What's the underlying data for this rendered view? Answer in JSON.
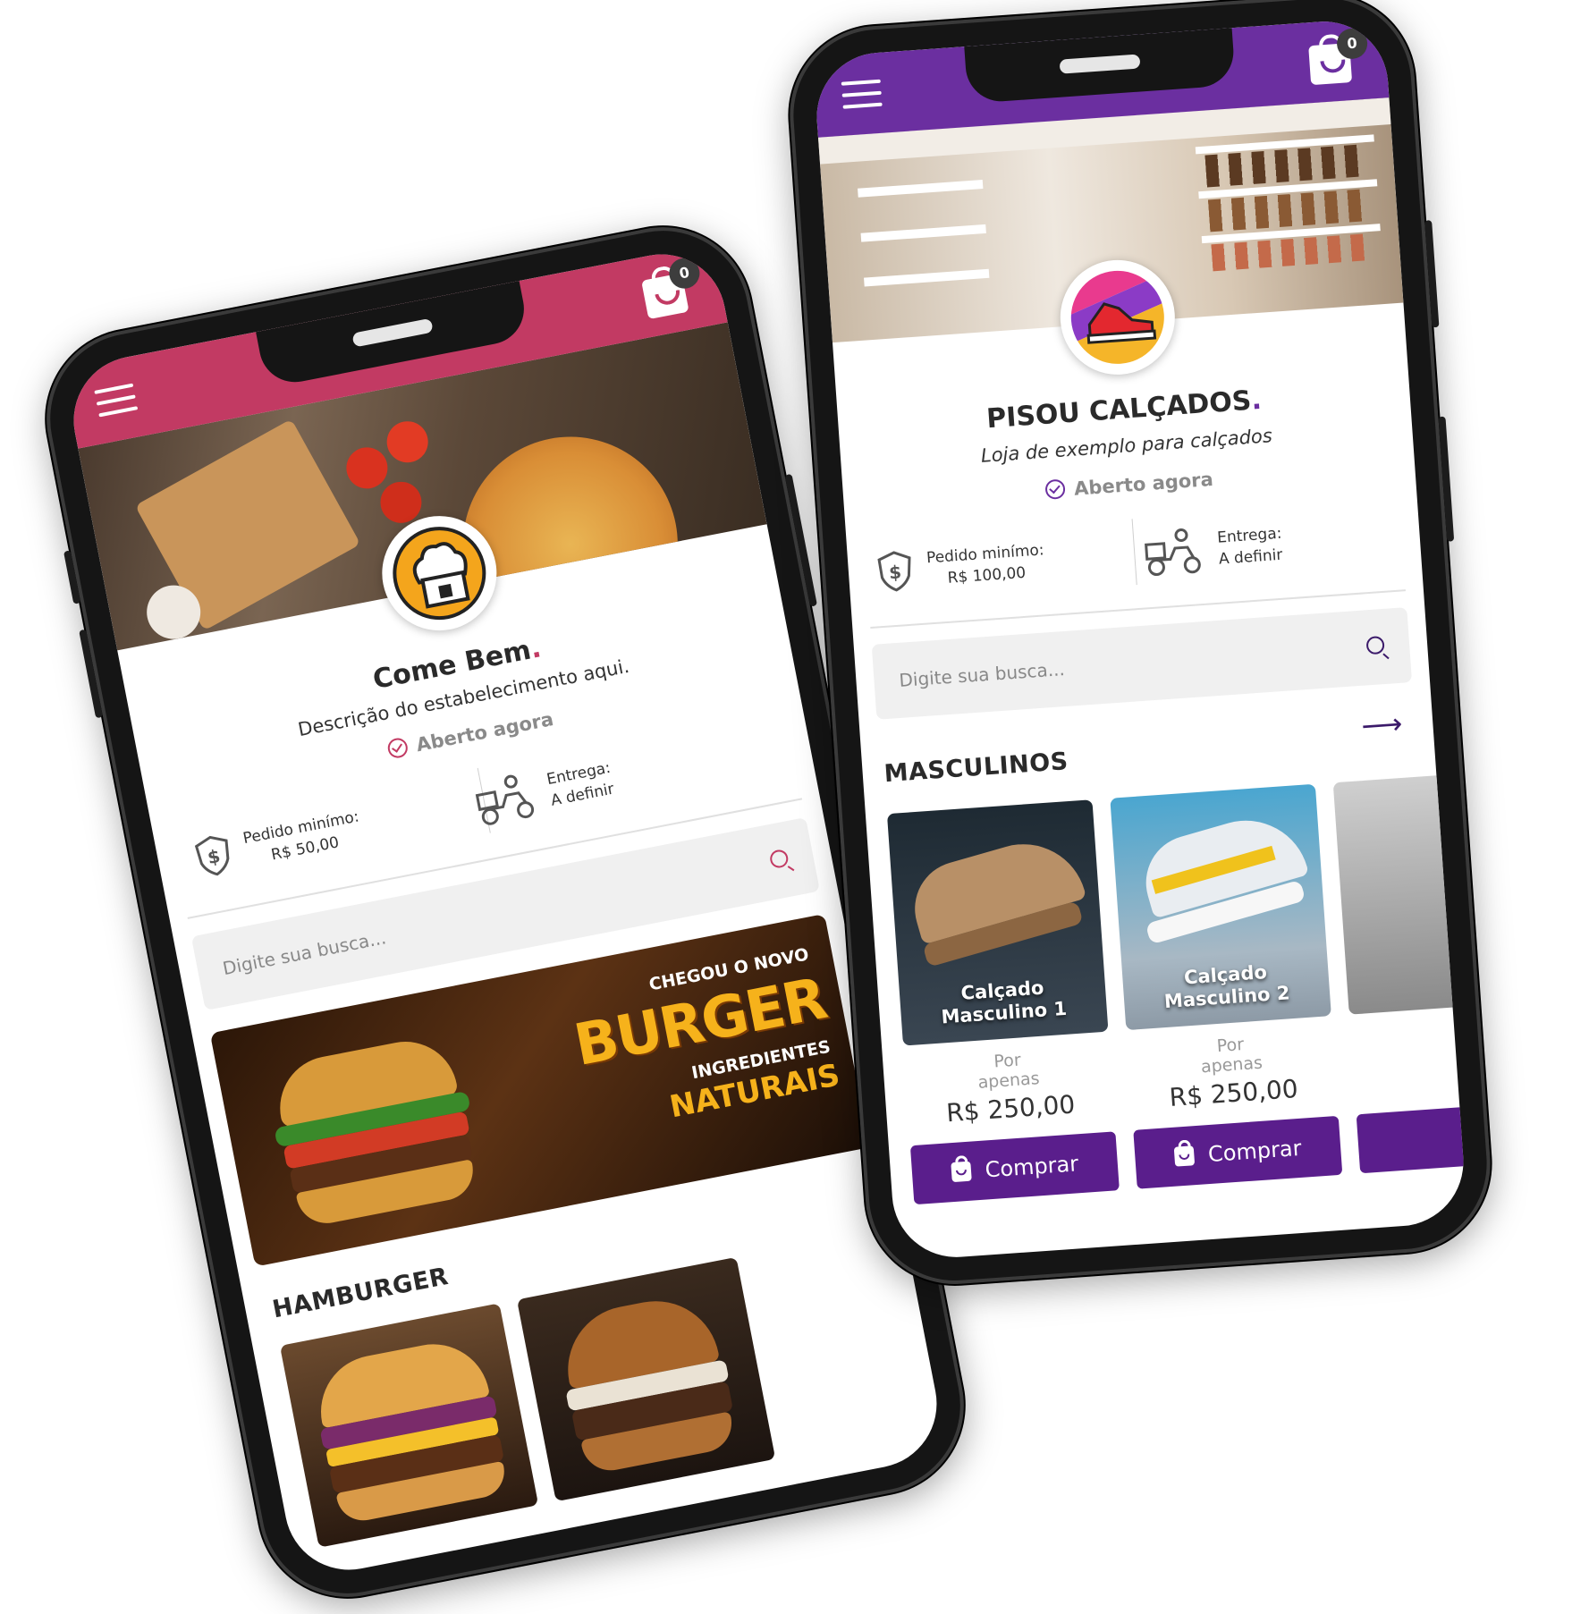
{
  "phone_food": {
    "brand_color": "#c23a63",
    "cart_count": "0",
    "shop_name": "Come Bem",
    "shop_name_dot": ".",
    "description": "Descrição do estabelecimento aqui.",
    "status": "Aberto agora",
    "min_order_label": "Pedido minímo:",
    "min_order_value": "R$ 50,00",
    "delivery_label": "Entrega:",
    "delivery_value": "A definir",
    "search_placeholder": "Digite sua busca...",
    "banner": {
      "line1": "CHEGOU O NOVO",
      "line2": "BURGER",
      "line3": "INGREDIENTES",
      "line4": "NATURAIS"
    },
    "section_title": "HAMBURGER",
    "icons": [
      "menu-icon",
      "shopping-bag-icon",
      "chef-hat-house-icon",
      "check-circle-icon",
      "dollar-shield-icon",
      "delivery-scooter-icon",
      "search-icon"
    ]
  },
  "phone_shoes": {
    "brand_color": "#6b2fa0",
    "cart_count": "0",
    "shop_name": "PISOU CALÇADOS",
    "shop_name_dot": ".",
    "description": "Loja de exemplo para calçados",
    "status": "Aberto agora",
    "min_order_label": "Pedido minímo:",
    "min_order_value": "R$ 100,00",
    "delivery_label": "Entrega:",
    "delivery_value": "A definir",
    "search_placeholder": "Digite sua busca...",
    "section_title": "MASCULINOS",
    "products": [
      {
        "name_line1": "Calçado",
        "name_line2": "Masculino 1",
        "price_prefix_1": "Por",
        "price_prefix_2": "apenas",
        "price": "R$ 250,00",
        "buy_label": "Comprar"
      },
      {
        "name_line1": "Calçado",
        "name_line2": "Masculino 2",
        "price_prefix_1": "Por",
        "price_prefix_2": "apenas",
        "price": "R$ 250,00",
        "buy_label": "Comprar"
      }
    ],
    "icons": [
      "menu-icon",
      "shopping-bag-icon",
      "sneaker-logo-icon",
      "check-circle-icon",
      "dollar-shield-icon",
      "delivery-scooter-icon",
      "search-icon",
      "arrow-right-icon"
    ]
  }
}
